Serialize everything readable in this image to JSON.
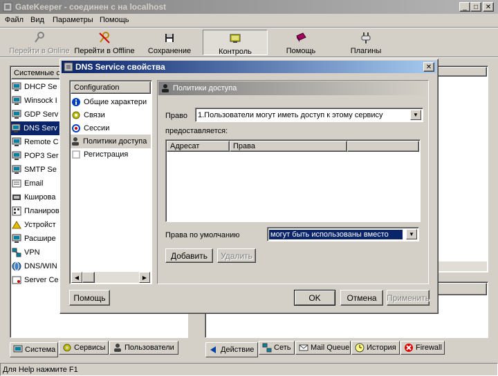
{
  "window": {
    "title": "GateKeeper - соединен с на localhost"
  },
  "menu": [
    "Файл",
    "Вид",
    "Параметры",
    "Помощь"
  ],
  "toolbar": [
    {
      "label": "Перейти в Online",
      "icon": "key-icon",
      "disabled": true
    },
    {
      "label": "Перейти в Offline",
      "icon": "key-red-icon",
      "disabled": false
    },
    {
      "label": "Сохранение",
      "icon": "floppy-icon",
      "disabled": false
    },
    {
      "label": "Контроль",
      "icon": "monitor-icon",
      "disabled": false
    },
    {
      "label": "Помощь",
      "icon": "book-icon",
      "disabled": false
    },
    {
      "label": "Плагины",
      "icon": "plug-icon",
      "disabled": false
    }
  ],
  "left_panel": {
    "header": "Системные с",
    "items": [
      "DHCP Se",
      "Winsock I",
      "GDP Serv",
      "DNS Serv",
      "Remote C",
      "POP3 Ser",
      "SMTP Se",
      "Email",
      "Кширова",
      "Планиров",
      "Устройст",
      "Расшире",
      "VPN",
      "DNS/WIN",
      "Server Ce"
    ],
    "selected_index": 3,
    "tabs": [
      "Система",
      "Сервисы",
      "Пользователи"
    ]
  },
  "right_panel": {
    "tabs": [
      "Действие",
      "Сеть",
      "Mail Queue",
      "История",
      "Firewall"
    ]
  },
  "statusbar": {
    "text": "Для Help нажмите F1"
  },
  "dialog": {
    "title": "DNS Service свойства",
    "tree_header": "Configuration",
    "tree_items": [
      "Общие характери",
      "Связи",
      "Сессии",
      "Политики доступа",
      "Регистрация"
    ],
    "tree_selected": 3,
    "panel_title": "Политики доступа",
    "right_label": "Право",
    "right_value": "1.Пользователи могут иметь доступ к этому сервису",
    "granted_label": "предоставляется:",
    "columns": [
      "Адресат",
      "Права"
    ],
    "default_label": "Права по умолчанию",
    "default_value": "могут быть использованы вместо",
    "add_button": "Добавить",
    "delete_button": "Удалить",
    "help_button": "Помощь",
    "ok_button": "OK",
    "cancel_button": "Отмена",
    "apply_button": "Применить"
  },
  "colors": {
    "selection": "#0a246a",
    "face": "#d4d0c8",
    "active_title": "#0a246a"
  }
}
